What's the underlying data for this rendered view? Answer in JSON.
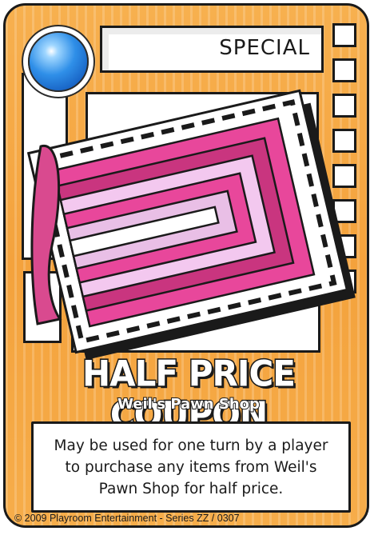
{
  "card": {
    "type_label": "SPECIAL",
    "title": "HALF PRICE COUPON",
    "subtitle": "Weil's Pawn Shop",
    "rules_text": "May be used for one turn by a player to purchase any items from Weil's Pawn Shop for half price.",
    "footer": "© 2009 Playroom Entertainment - Series ZZ / 0307",
    "gem_icon": "blue-orb-icon",
    "artwork": "coupon-illustration",
    "colors": {
      "frame_orange": "#f4a23c",
      "outline": "#1a1a1a",
      "gem_blue": "#2f8fe8",
      "stripe_hot_pink": "#e8479b",
      "stripe_magenta": "#c9357f",
      "stripe_light_pink": "#e9bfe6",
      "stripe_pale": "#f3c8ef"
    }
  }
}
